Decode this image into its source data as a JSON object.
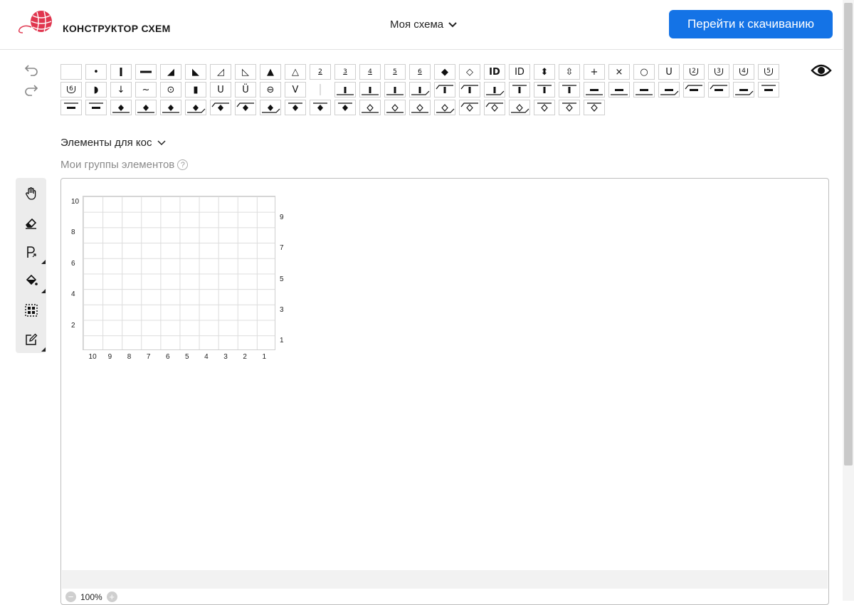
{
  "header": {
    "title": "КОНСТРУКТОР СХЕМ",
    "scheme_name": "Моя схема",
    "download_label": "Перейти к скачиванию",
    "accent": "#1473e6",
    "logo_color": "#e0364f"
  },
  "history": {
    "undo_icon": "undo-icon",
    "redo_icon": "redo-icon"
  },
  "preview_icon": "eye-icon",
  "palette": [
    {
      "name": "empty",
      "t": ""
    },
    {
      "name": "dot",
      "t": "•"
    },
    {
      "name": "vbar",
      "t": "vbar"
    },
    {
      "name": "hbar",
      "t": "hbar"
    },
    {
      "name": "tri-right",
      "t": "◢"
    },
    {
      "name": "tri-left",
      "t": "◣"
    },
    {
      "name": "tri-right-outline",
      "t": "◿"
    },
    {
      "name": "tri-left-outline",
      "t": "◺"
    },
    {
      "name": "triangle",
      "t": "▲"
    },
    {
      "name": "triangle-outline",
      "t": "△"
    },
    {
      "name": "v-2",
      "t": "2"
    },
    {
      "name": "v-3",
      "t": "3"
    },
    {
      "name": "v-4",
      "t": "4"
    },
    {
      "name": "v-5",
      "t": "5"
    },
    {
      "name": "v-6",
      "t": "6"
    },
    {
      "name": "diamond",
      "t": "◆"
    },
    {
      "name": "diamond-outline",
      "t": "◇"
    },
    {
      "name": "ID-bold",
      "t": "ID"
    },
    {
      "name": "ID",
      "t": "ID"
    },
    {
      "name": "double-diamond",
      "t": "⬍"
    },
    {
      "name": "double-diamond-outline",
      "t": "⇳"
    },
    {
      "name": "plus",
      "t": "+"
    },
    {
      "name": "cross",
      "t": "×"
    },
    {
      "name": "circle",
      "t": "○"
    },
    {
      "name": "u",
      "t": "U"
    },
    {
      "name": "u-2",
      "t": "2"
    },
    {
      "name": "u-3",
      "t": "3"
    },
    {
      "name": "u-4",
      "t": "4"
    },
    {
      "name": "u-5",
      "t": "5"
    },
    {
      "name": "u-6",
      "t": "6"
    },
    {
      "name": "half-circle",
      "t": "◗"
    },
    {
      "name": "down-arrow",
      "t": "↓"
    },
    {
      "name": "tilde",
      "t": "~"
    },
    {
      "name": "circle-dot",
      "t": "⊙"
    },
    {
      "name": "black-block",
      "t": "▮"
    },
    {
      "name": "u-outline",
      "t": "U"
    },
    {
      "name": "u-dot",
      "t": "Ü"
    },
    {
      "name": "theta",
      "t": "⊖"
    },
    {
      "name": "v-letter",
      "t": "V"
    },
    {
      "name": "separator",
      "t": "sep"
    },
    {
      "name": "cable-vbar-1",
      "t": "c1"
    },
    {
      "name": "cable-vbar-2",
      "t": "c1"
    },
    {
      "name": "cable-vbar-3",
      "t": "c1"
    },
    {
      "name": "cable-vbar-4",
      "t": "c2"
    },
    {
      "name": "cable-vbar-5",
      "t": "c3"
    },
    {
      "name": "cable-vbar-6",
      "t": "c3"
    },
    {
      "name": "cable-vbar-7",
      "t": "c2"
    },
    {
      "name": "cable-vbar-8",
      "t": "c4"
    },
    {
      "name": "cable-vbar-9",
      "t": "c4"
    },
    {
      "name": "cable-vbar-10",
      "t": "c4"
    },
    {
      "name": "cable-hbar-1",
      "t": "h1"
    },
    {
      "name": "cable-hbar-2",
      "t": "h1"
    },
    {
      "name": "cable-hbar-3",
      "t": "h1"
    },
    {
      "name": "cable-hbar-4",
      "t": "h2"
    },
    {
      "name": "cable-hbar-5",
      "t": "h3"
    },
    {
      "name": "cable-hbar-6",
      "t": "h3"
    },
    {
      "name": "cable-hbar-7",
      "t": "h2"
    },
    {
      "name": "cable-hbar-8",
      "t": "h4"
    },
    {
      "name": "cable-hbar-9",
      "t": "h4"
    },
    {
      "name": "cable-hbar-10",
      "t": "h4"
    },
    {
      "name": "cable-diamond-1",
      "t": "d1"
    },
    {
      "name": "cable-diamond-2",
      "t": "d1"
    },
    {
      "name": "cable-diamond-3",
      "t": "d1"
    },
    {
      "name": "cable-diamond-4",
      "t": "d2"
    },
    {
      "name": "cable-diamond-5",
      "t": "d3"
    },
    {
      "name": "cable-diamond-6",
      "t": "d3"
    },
    {
      "name": "cable-diamond-7",
      "t": "d2"
    },
    {
      "name": "cable-diamond-8",
      "t": "d4"
    },
    {
      "name": "cable-diamond-9",
      "t": "d4"
    },
    {
      "name": "cable-diamond-10",
      "t": "d4"
    },
    {
      "name": "cable-odiamond-1",
      "t": "o1"
    },
    {
      "name": "cable-odiamond-2",
      "t": "o1"
    },
    {
      "name": "cable-odiamond-3",
      "t": "o1"
    },
    {
      "name": "cable-odiamond-4",
      "t": "o2"
    },
    {
      "name": "cable-odiamond-5",
      "t": "o3"
    },
    {
      "name": "cable-odiamond-6",
      "t": "o3"
    },
    {
      "name": "cable-odiamond-7",
      "t": "o2"
    },
    {
      "name": "cable-odiamond-8",
      "t": "o4"
    },
    {
      "name": "cable-odiamond-9",
      "t": "o4"
    },
    {
      "name": "cable-odiamond-10",
      "t": "o4"
    }
  ],
  "braid_elements_label": "Элементы для кос",
  "my_groups_label": "Мои группы элементов",
  "help_mark": "?",
  "tools": [
    {
      "name": "hand-tool",
      "icon": "hand-icon"
    },
    {
      "name": "eraser-tool",
      "icon": "eraser-icon"
    },
    {
      "name": "pattern-tool",
      "icon": "pattern-icon"
    },
    {
      "name": "fill-tool",
      "icon": "fill-bucket-icon"
    },
    {
      "name": "select-tool",
      "icon": "select-grid-icon"
    },
    {
      "name": "edit-tool",
      "icon": "edit-icon"
    }
  ],
  "grid": {
    "rows": 10,
    "cols": 10,
    "left_labels": [
      "10",
      "8",
      "6",
      "4",
      "2"
    ],
    "right_labels": [
      "9",
      "7",
      "5",
      "3",
      "1"
    ],
    "bottom_labels": [
      "10",
      "9",
      "8",
      "7",
      "6",
      "5",
      "4",
      "3",
      "2",
      "1"
    ]
  },
  "zoom": {
    "minus": "−",
    "value": "100%",
    "plus": "+"
  }
}
